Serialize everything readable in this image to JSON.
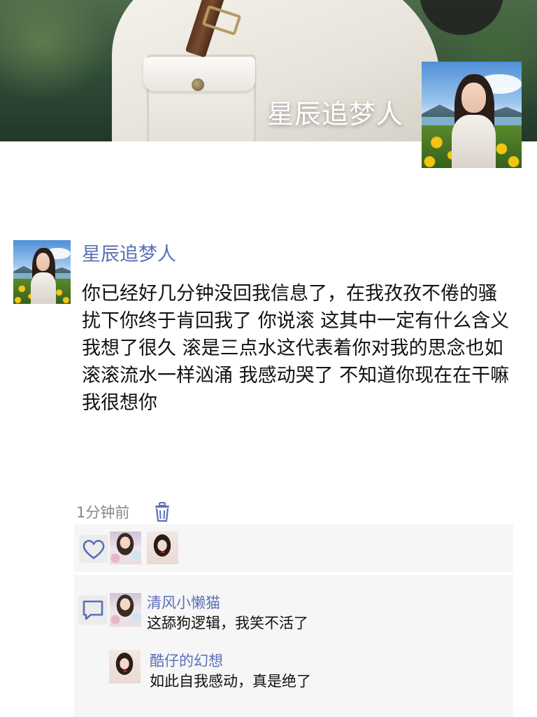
{
  "cover": {
    "title": "星辰追梦人"
  },
  "post": {
    "author": "星辰追梦人",
    "text": "你已经好几分钟没回我信息了，在我孜孜不倦的骚扰下你终于肯回我了 你说滚 这其中一定有什么含义 我想了很久 滚是三点水这代表着你对我的思念也如滚滚流水一样汹涌 我感动哭了 不知道你现在在干嘛 我很想你",
    "timestamp": "1分钟前"
  },
  "likes": {
    "count_avatars": 2
  },
  "comments": [
    {
      "name": "清风小懒猫",
      "text": "这舔狗逻辑，我笑不活了"
    },
    {
      "name": "酷仔的幻想",
      "text": "如此自我感动，真是绝了"
    }
  ],
  "colors": {
    "link_blue": "#5a6fb8",
    "panel_bg": "#f6f6f6",
    "text": "#111111",
    "muted": "#888888"
  },
  "icons": {
    "delete": "trash-icon",
    "like": "heart-icon",
    "comment": "comment-icon"
  }
}
